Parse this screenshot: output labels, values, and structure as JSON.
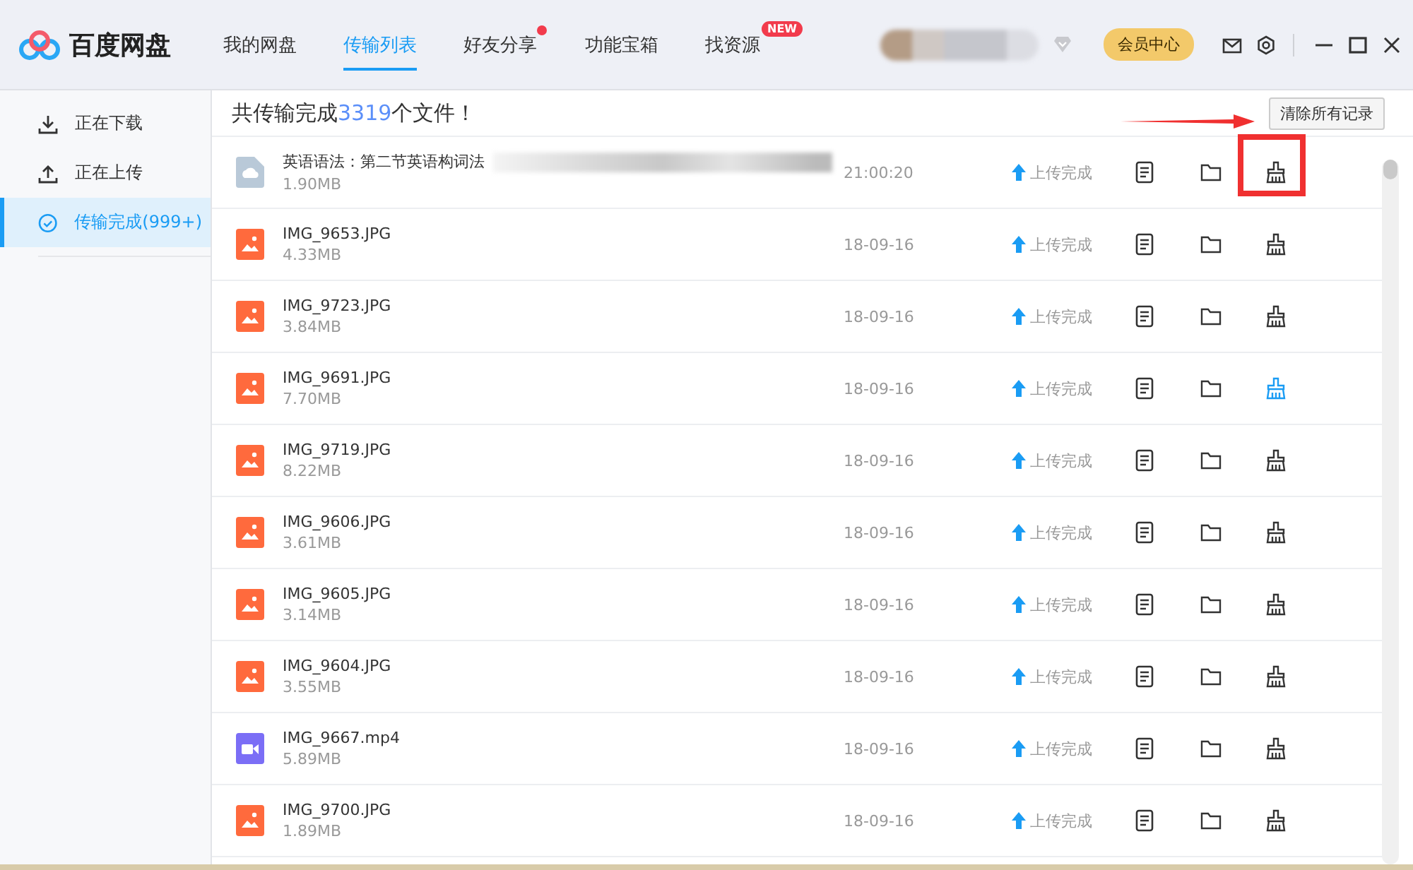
{
  "app": {
    "name": "百度网盘"
  },
  "tabs": [
    {
      "label": "我的网盘",
      "selected": false,
      "notification_dot": false
    },
    {
      "label": "传输列表",
      "selected": true,
      "notification_dot": false
    },
    {
      "label": "好友分享",
      "selected": false,
      "notification_dot": true
    },
    {
      "label": "功能宝箱",
      "selected": false,
      "notification_dot": false
    },
    {
      "label": "找资源",
      "selected": false,
      "notification_dot": false,
      "badge": "NEW"
    }
  ],
  "vip_button": "会员中心",
  "sidebar": {
    "items": [
      {
        "label": "正在下载",
        "selected": false
      },
      {
        "label": "正在上传",
        "selected": false
      },
      {
        "label": "传输完成(999+)",
        "selected": true
      }
    ]
  },
  "summary": {
    "before": "共传输完成",
    "count": "3319",
    "after": "个文件！"
  },
  "clear_button": "清除所有记录",
  "files": [
    {
      "kind": "doc",
      "name": "英语语法：第二节英语构词法",
      "size": "1.90MB",
      "time": "21:00:20",
      "status": "上传完成",
      "blurred": true,
      "hovered": false,
      "highlighted": true
    },
    {
      "kind": "image",
      "name": "IMG_9653.JPG",
      "size": "4.33MB",
      "time": "18-09-16",
      "status": "上传完成",
      "blurred": false,
      "hovered": false,
      "highlighted": false
    },
    {
      "kind": "image",
      "name": "IMG_9723.JPG",
      "size": "3.84MB",
      "time": "18-09-16",
      "status": "上传完成",
      "blurred": false,
      "hovered": false,
      "highlighted": false
    },
    {
      "kind": "image",
      "name": "IMG_9691.JPG",
      "size": "7.70MB",
      "time": "18-09-16",
      "status": "上传完成",
      "blurred": false,
      "hovered": true,
      "highlighted": false
    },
    {
      "kind": "image",
      "name": "IMG_9719.JPG",
      "size": "8.22MB",
      "time": "18-09-16",
      "status": "上传完成",
      "blurred": false,
      "hovered": false,
      "highlighted": false
    },
    {
      "kind": "image",
      "name": "IMG_9606.JPG",
      "size": "3.61MB",
      "time": "18-09-16",
      "status": "上传完成",
      "blurred": false,
      "hovered": false,
      "highlighted": false
    },
    {
      "kind": "image",
      "name": "IMG_9605.JPG",
      "size": "3.14MB",
      "time": "18-09-16",
      "status": "上传完成",
      "blurred": false,
      "hovered": false,
      "highlighted": false
    },
    {
      "kind": "image",
      "name": "IMG_9604.JPG",
      "size": "3.55MB",
      "time": "18-09-16",
      "status": "上传完成",
      "blurred": false,
      "hovered": false,
      "highlighted": false
    },
    {
      "kind": "video",
      "name": "IMG_9667.mp4",
      "size": "5.89MB",
      "time": "18-09-16",
      "status": "上传完成",
      "blurred": false,
      "hovered": false,
      "highlighted": false
    },
    {
      "kind": "image",
      "name": "IMG_9700.JPG",
      "size": "1.89MB",
      "time": "18-09-16",
      "status": "上传完成",
      "blurred": false,
      "hovered": false,
      "highlighted": false
    }
  ]
}
